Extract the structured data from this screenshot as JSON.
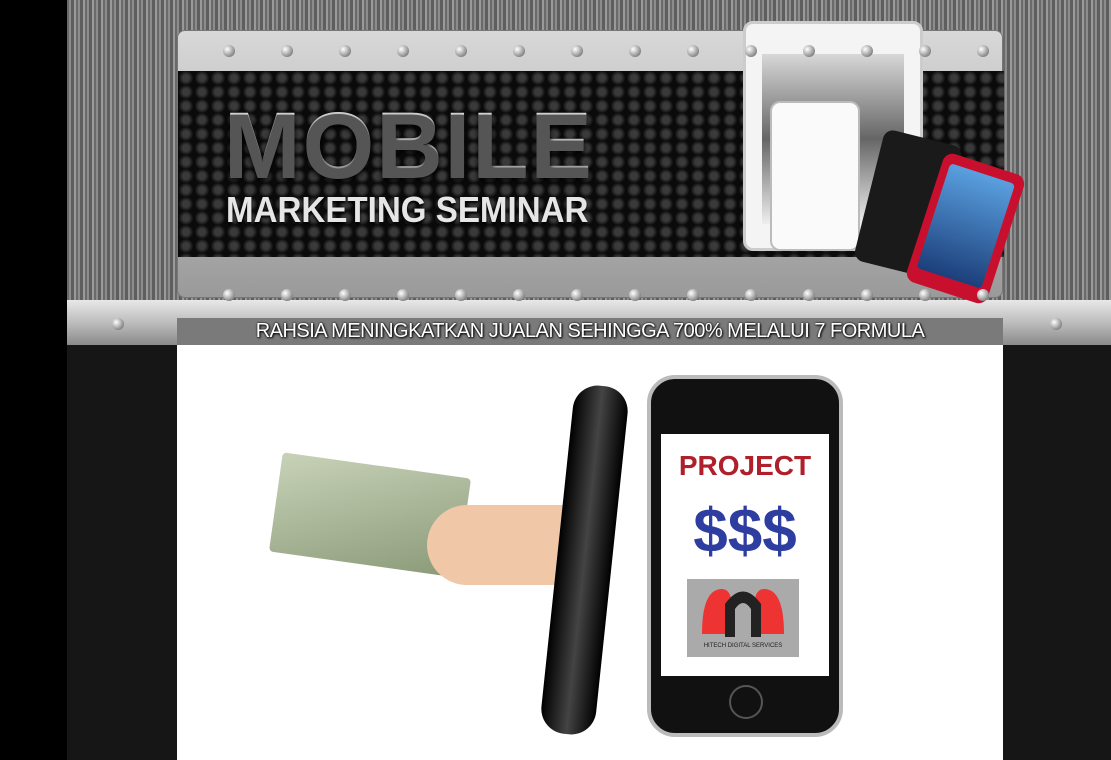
{
  "header": {
    "title": "MOBILE",
    "subtitle": "MARKETING SEMINAR"
  },
  "tagline": "RAHSIA MENINGKATKAN JUALAN SEHINGGA 700% MELALUI 7 FORMULA",
  "hero": {
    "screen_heading": "PROJECT",
    "screen_symbols": "$$$",
    "logo_text": "HITECH DIGITAL SERVICES"
  },
  "colors": {
    "project_red": "#b0202a",
    "dollar_blue": "#2e3da0"
  }
}
